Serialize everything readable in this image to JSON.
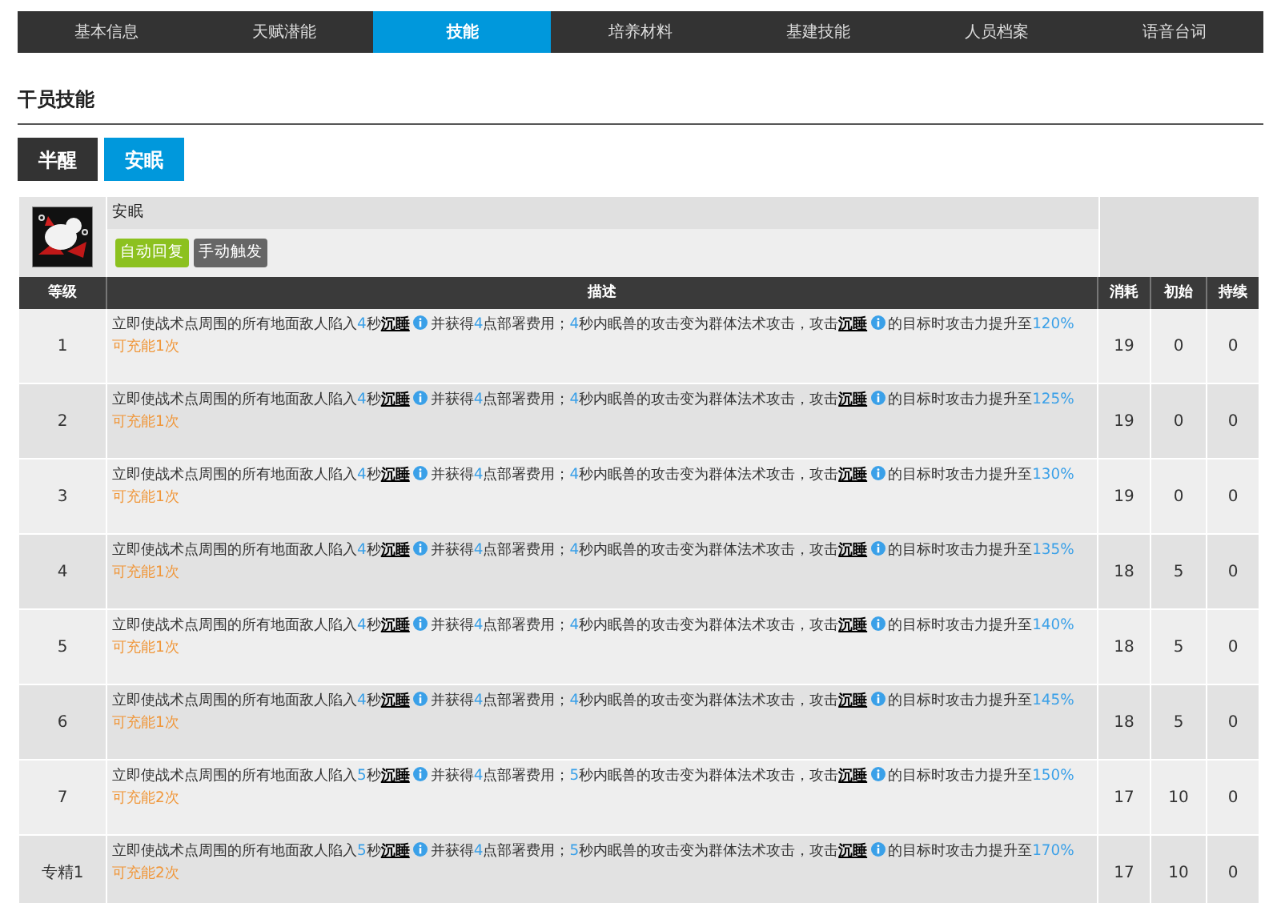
{
  "tabs": [
    {
      "label": "基本信息",
      "selected": false
    },
    {
      "label": "天赋潜能",
      "selected": false
    },
    {
      "label": "技能",
      "selected": true
    },
    {
      "label": "培养材料",
      "selected": false
    },
    {
      "label": "基建技能",
      "selected": false
    },
    {
      "label": "人员档案",
      "selected": false
    },
    {
      "label": "语音台词",
      "selected": false
    }
  ],
  "section_title": "干员技能",
  "skill_tabs": [
    {
      "label": "半醒",
      "selected": false
    },
    {
      "label": "安眠",
      "selected": true
    }
  ],
  "skill": {
    "name": "安眠",
    "tags": [
      {
        "label": "自动回复",
        "color": "#8cc11f"
      },
      {
        "label": "手动触发",
        "color": "#666666"
      }
    ]
  },
  "table": {
    "columns": [
      "等级",
      "描述",
      "消耗",
      "初始",
      "持续"
    ],
    "rows": [
      {
        "level": "1",
        "description": [
          {
            "kind": "plain",
            "text": "立即使战术点周围的所有地面敌人陷入"
          },
          {
            "kind": "value",
            "text": "4"
          },
          {
            "kind": "plain",
            "text": "秒"
          },
          {
            "kind": "term",
            "text": "沉睡"
          },
          {
            "kind": "plain",
            "text": "并获得"
          },
          {
            "kind": "value",
            "text": "4"
          },
          {
            "kind": "plain",
            "text": "点部署费用；"
          },
          {
            "kind": "value",
            "text": "4"
          },
          {
            "kind": "plain",
            "text": "秒内眠兽的攻击变为群体法术攻击，攻击"
          },
          {
            "kind": "term",
            "text": "沉睡"
          },
          {
            "kind": "plain",
            "text": "的目标时攻击力提升至"
          },
          {
            "kind": "value",
            "text": "120%"
          }
        ],
        "charges": "可充能1次",
        "cost": "19",
        "initial": "0",
        "duration": "0"
      },
      {
        "level": "2",
        "description": [
          {
            "kind": "plain",
            "text": "立即使战术点周围的所有地面敌人陷入"
          },
          {
            "kind": "value",
            "text": "4"
          },
          {
            "kind": "plain",
            "text": "秒"
          },
          {
            "kind": "term",
            "text": "沉睡"
          },
          {
            "kind": "plain",
            "text": "并获得"
          },
          {
            "kind": "value",
            "text": "4"
          },
          {
            "kind": "plain",
            "text": "点部署费用；"
          },
          {
            "kind": "value",
            "text": "4"
          },
          {
            "kind": "plain",
            "text": "秒内眠兽的攻击变为群体法术攻击，攻击"
          },
          {
            "kind": "term",
            "text": "沉睡"
          },
          {
            "kind": "plain",
            "text": "的目标时攻击力提升至"
          },
          {
            "kind": "value",
            "text": "125%"
          }
        ],
        "charges": "可充能1次",
        "cost": "19",
        "initial": "0",
        "duration": "0"
      },
      {
        "level": "3",
        "description": [
          {
            "kind": "plain",
            "text": "立即使战术点周围的所有地面敌人陷入"
          },
          {
            "kind": "value",
            "text": "4"
          },
          {
            "kind": "plain",
            "text": "秒"
          },
          {
            "kind": "term",
            "text": "沉睡"
          },
          {
            "kind": "plain",
            "text": "并获得"
          },
          {
            "kind": "value",
            "text": "4"
          },
          {
            "kind": "plain",
            "text": "点部署费用；"
          },
          {
            "kind": "value",
            "text": "4"
          },
          {
            "kind": "plain",
            "text": "秒内眠兽的攻击变为群体法术攻击，攻击"
          },
          {
            "kind": "term",
            "text": "沉睡"
          },
          {
            "kind": "plain",
            "text": "的目标时攻击力提升至"
          },
          {
            "kind": "value",
            "text": "130%"
          }
        ],
        "charges": "可充能1次",
        "cost": "19",
        "initial": "0",
        "duration": "0"
      },
      {
        "level": "4",
        "description": [
          {
            "kind": "plain",
            "text": "立即使战术点周围的所有地面敌人陷入"
          },
          {
            "kind": "value",
            "text": "4"
          },
          {
            "kind": "plain",
            "text": "秒"
          },
          {
            "kind": "term",
            "text": "沉睡"
          },
          {
            "kind": "plain",
            "text": "并获得"
          },
          {
            "kind": "value",
            "text": "4"
          },
          {
            "kind": "plain",
            "text": "点部署费用；"
          },
          {
            "kind": "value",
            "text": "4"
          },
          {
            "kind": "plain",
            "text": "秒内眠兽的攻击变为群体法术攻击，攻击"
          },
          {
            "kind": "term",
            "text": "沉睡"
          },
          {
            "kind": "plain",
            "text": "的目标时攻击力提升至"
          },
          {
            "kind": "value",
            "text": "135%"
          }
        ],
        "charges": "可充能1次",
        "cost": "18",
        "initial": "5",
        "duration": "0"
      },
      {
        "level": "5",
        "description": [
          {
            "kind": "plain",
            "text": "立即使战术点周围的所有地面敌人陷入"
          },
          {
            "kind": "value",
            "text": "4"
          },
          {
            "kind": "plain",
            "text": "秒"
          },
          {
            "kind": "term",
            "text": "沉睡"
          },
          {
            "kind": "plain",
            "text": "并获得"
          },
          {
            "kind": "value",
            "text": "4"
          },
          {
            "kind": "plain",
            "text": "点部署费用；"
          },
          {
            "kind": "value",
            "text": "4"
          },
          {
            "kind": "plain",
            "text": "秒内眠兽的攻击变为群体法术攻击，攻击"
          },
          {
            "kind": "term",
            "text": "沉睡"
          },
          {
            "kind": "plain",
            "text": "的目标时攻击力提升至"
          },
          {
            "kind": "value",
            "text": "140%"
          }
        ],
        "charges": "可充能1次",
        "cost": "18",
        "initial": "5",
        "duration": "0"
      },
      {
        "level": "6",
        "description": [
          {
            "kind": "plain",
            "text": "立即使战术点周围的所有地面敌人陷入"
          },
          {
            "kind": "value",
            "text": "4"
          },
          {
            "kind": "plain",
            "text": "秒"
          },
          {
            "kind": "term",
            "text": "沉睡"
          },
          {
            "kind": "plain",
            "text": "并获得"
          },
          {
            "kind": "value",
            "text": "4"
          },
          {
            "kind": "plain",
            "text": "点部署费用；"
          },
          {
            "kind": "value",
            "text": "4"
          },
          {
            "kind": "plain",
            "text": "秒内眠兽的攻击变为群体法术攻击，攻击"
          },
          {
            "kind": "term",
            "text": "沉睡"
          },
          {
            "kind": "plain",
            "text": "的目标时攻击力提升至"
          },
          {
            "kind": "value",
            "text": "145%"
          }
        ],
        "charges": "可充能1次",
        "cost": "18",
        "initial": "5",
        "duration": "0"
      },
      {
        "level": "7",
        "description": [
          {
            "kind": "plain",
            "text": "立即使战术点周围的所有地面敌人陷入"
          },
          {
            "kind": "value",
            "text": "5"
          },
          {
            "kind": "plain",
            "text": "秒"
          },
          {
            "kind": "term",
            "text": "沉睡"
          },
          {
            "kind": "plain",
            "text": "并获得"
          },
          {
            "kind": "value",
            "text": "4"
          },
          {
            "kind": "plain",
            "text": "点部署费用；"
          },
          {
            "kind": "value",
            "text": "5"
          },
          {
            "kind": "plain",
            "text": "秒内眠兽的攻击变为群体法术攻击，攻击"
          },
          {
            "kind": "term",
            "text": "沉睡"
          },
          {
            "kind": "plain",
            "text": "的目标时攻击力提升至"
          },
          {
            "kind": "value",
            "text": "150%"
          }
        ],
        "charges": "可充能2次",
        "cost": "17",
        "initial": "10",
        "duration": "0"
      },
      {
        "level": "专精1",
        "description": [
          {
            "kind": "plain",
            "text": "立即使战术点周围的所有地面敌人陷入"
          },
          {
            "kind": "value",
            "text": "5"
          },
          {
            "kind": "plain",
            "text": "秒"
          },
          {
            "kind": "term",
            "text": "沉睡"
          },
          {
            "kind": "plain",
            "text": "并获得"
          },
          {
            "kind": "value",
            "text": "4"
          },
          {
            "kind": "plain",
            "text": "点部署费用；"
          },
          {
            "kind": "value",
            "text": "5"
          },
          {
            "kind": "plain",
            "text": "秒内眠兽的攻击变为群体法术攻击，攻击"
          },
          {
            "kind": "term",
            "text": "沉睡"
          },
          {
            "kind": "plain",
            "text": "的目标时攻击力提升至"
          },
          {
            "kind": "value",
            "text": "170%"
          }
        ],
        "charges": "可充能2次",
        "cost": "17",
        "initial": "10",
        "duration": "0"
      }
    ]
  }
}
